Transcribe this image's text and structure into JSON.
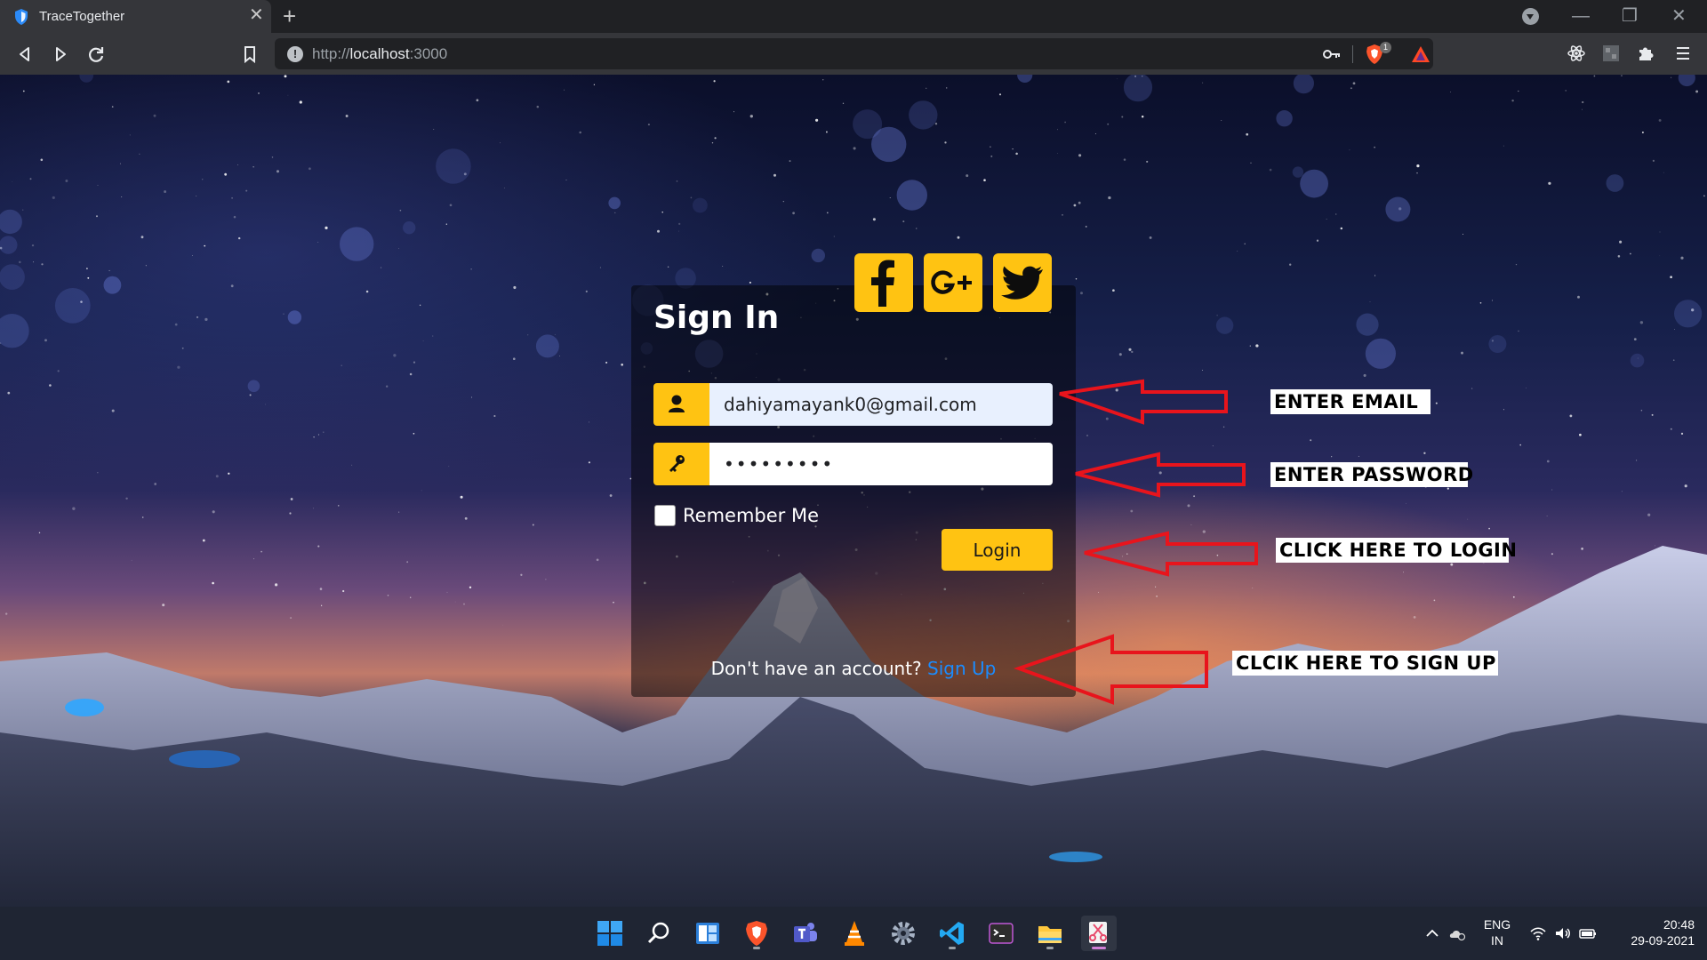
{
  "browser": {
    "tab_title": "TraceTogether",
    "tab_close": "✕",
    "new_tab": "+",
    "url_scheme": "http://",
    "url_host": "localhost",
    "url_port": ":3000",
    "shield_count": "1",
    "window_controls": {
      "minimize": "—",
      "restore": "❐",
      "close": "✕"
    }
  },
  "signin": {
    "title": "Sign In",
    "email_value": "dahiyamayank0@gmail.com",
    "password_value": "•••••••••",
    "remember_label": "Remember Me",
    "login_label": "Login",
    "no_account_text": "Don't have an account? ",
    "signup_link": "Sign Up",
    "social": [
      "facebook",
      "google-plus",
      "twitter"
    ]
  },
  "annotations": {
    "email": "ENTER EMAIL",
    "password": "ENTER PASSWORD",
    "login": "CLICK HERE TO LOGIN",
    "signup": "CLCIK HERE TO SIGN UP"
  },
  "taskbar": {
    "apps": [
      "start",
      "search",
      "widgets",
      "brave",
      "teams",
      "vlc",
      "settings",
      "vscode",
      "terminal",
      "file-explorer",
      "snipping-tool"
    ],
    "lang_primary": "ENG",
    "lang_secondary": "IN",
    "time": "20:48",
    "date": "29-09-2021"
  },
  "colors": {
    "accent_yellow": "#ffc312",
    "link_blue": "#1a8cff",
    "annotation_red": "#e8141c"
  }
}
